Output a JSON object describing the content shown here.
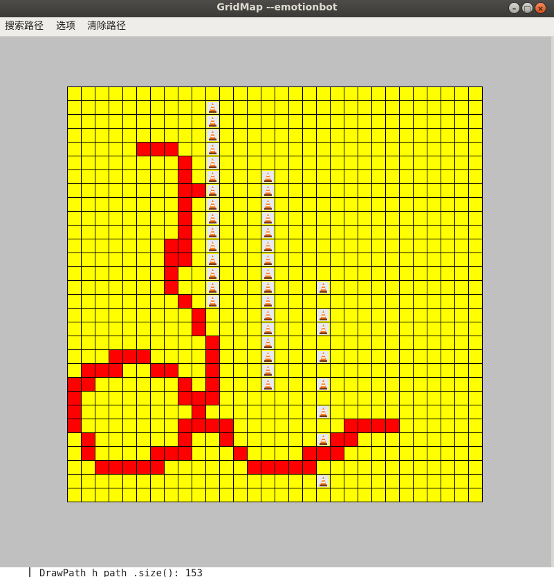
{
  "window": {
    "title": "GridMap --emotionbot",
    "controls": {
      "minimize_icon": "minimize-icon",
      "maximize_icon": "maximize-icon",
      "close_icon": "close-icon"
    }
  },
  "menu": {
    "items": [
      {
        "label": "搜索路径"
      },
      {
        "label": "选项"
      },
      {
        "label": "清除路径"
      }
    ]
  },
  "grid": {
    "rows": 30,
    "cols": 30,
    "colors": {
      "free": "#ffff00",
      "path": "#ff0000",
      "line": "#000000",
      "cone_bg": "#e6eaf3"
    },
    "obstacle_icon": "traffic-cone-icon",
    "obstacles": [
      [
        1,
        10
      ],
      [
        2,
        10
      ],
      [
        3,
        10
      ],
      [
        4,
        10
      ],
      [
        5,
        10
      ],
      [
        6,
        10
      ],
      [
        7,
        10
      ],
      [
        8,
        10
      ],
      [
        9,
        10
      ],
      [
        10,
        10
      ],
      [
        11,
        10
      ],
      [
        12,
        10
      ],
      [
        13,
        10
      ],
      [
        14,
        10
      ],
      [
        15,
        10
      ],
      [
        6,
        14
      ],
      [
        7,
        14
      ],
      [
        8,
        14
      ],
      [
        9,
        14
      ],
      [
        10,
        14
      ],
      [
        11,
        14
      ],
      [
        12,
        14
      ],
      [
        13,
        14
      ],
      [
        14,
        14
      ],
      [
        15,
        14
      ],
      [
        16,
        14
      ],
      [
        17,
        14
      ],
      [
        18,
        14
      ],
      [
        19,
        14
      ],
      [
        20,
        14
      ],
      [
        21,
        14
      ],
      [
        14,
        18
      ],
      [
        16,
        18
      ],
      [
        17,
        18
      ],
      [
        19,
        18
      ],
      [
        21,
        18
      ],
      [
        23,
        18
      ],
      [
        25,
        18
      ],
      [
        28,
        18
      ]
    ],
    "path": [
      [
        4,
        5
      ],
      [
        4,
        6
      ],
      [
        4,
        7
      ],
      [
        5,
        8
      ],
      [
        6,
        8
      ],
      [
        7,
        8
      ],
      [
        7,
        9
      ],
      [
        8,
        8
      ],
      [
        9,
        8
      ],
      [
        10,
        8
      ],
      [
        11,
        8
      ],
      [
        11,
        7
      ],
      [
        12,
        8
      ],
      [
        12,
        7
      ],
      [
        13,
        7
      ],
      [
        14,
        7
      ],
      [
        15,
        8
      ],
      [
        16,
        9
      ],
      [
        17,
        9
      ],
      [
        18,
        10
      ],
      [
        19,
        10
      ],
      [
        20,
        10
      ],
      [
        21,
        10
      ],
      [
        22,
        10
      ],
      [
        22,
        9
      ],
      [
        22,
        8
      ],
      [
        21,
        8
      ],
      [
        20,
        6
      ],
      [
        20,
        7
      ],
      [
        19,
        3
      ],
      [
        19,
        4
      ],
      [
        19,
        5
      ],
      [
        20,
        1
      ],
      [
        20,
        2
      ],
      [
        20,
        3
      ],
      [
        21,
        0
      ],
      [
        21,
        1
      ],
      [
        22,
        0
      ],
      [
        23,
        0
      ],
      [
        24,
        0
      ],
      [
        24,
        8
      ],
      [
        24,
        9
      ],
      [
        24,
        10
      ],
      [
        23,
        9
      ],
      [
        25,
        1
      ],
      [
        26,
        1
      ],
      [
        27,
        2
      ],
      [
        27,
        3
      ],
      [
        27,
        4
      ],
      [
        27,
        5
      ],
      [
        27,
        6
      ],
      [
        26,
        6
      ],
      [
        26,
        7
      ],
      [
        26,
        8
      ],
      [
        25,
        8
      ],
      [
        24,
        11
      ],
      [
        25,
        11
      ],
      [
        26,
        12
      ],
      [
        27,
        13
      ],
      [
        27,
        14
      ],
      [
        27,
        15
      ],
      [
        27,
        16
      ],
      [
        27,
        17
      ],
      [
        26,
        17
      ],
      [
        26,
        18
      ],
      [
        26,
        19
      ],
      [
        25,
        19
      ],
      [
        25,
        20
      ],
      [
        24,
        20
      ],
      [
        24,
        21
      ],
      [
        24,
        22
      ],
      [
        24,
        23
      ]
    ]
  },
  "console": {
    "text": "DrawPath h_path .size(): 153"
  }
}
